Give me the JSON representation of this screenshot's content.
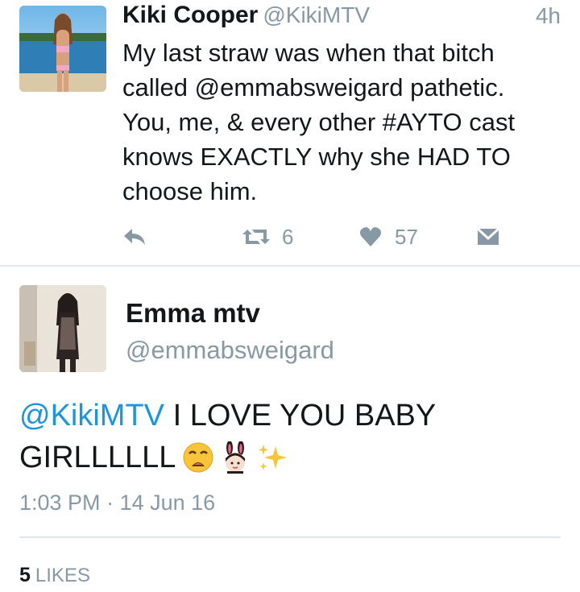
{
  "tweet1": {
    "name": "Kiki Cooper",
    "handle": "@KikiMTV",
    "time": "4h",
    "text": "My last straw was when that bitch called @emmabsweigard pathetic. You, me, & every other #AYTO cast knows EXACTLY why she HAD TO choose him.",
    "retweets": "6",
    "likes": "57",
    "icons": [
      "reply-icon",
      "retweet-icon",
      "heart-icon",
      "direct-message-icon"
    ]
  },
  "tweet2": {
    "name": "Emma mtv",
    "handle": "@emmabsweigard",
    "mention": "@KikiMTV",
    "text_line1": " I LOVE YOU BABY",
    "text_line2": "GIRLLLLLL",
    "emojis": [
      "weary-face-emoji",
      "bunny-girl-emoji",
      "sparkles-emoji"
    ],
    "time": "1:03 PM",
    "separator": "·",
    "date": "14 Jun 16",
    "likes_count": "5",
    "likes_label": "LIKES"
  },
  "colors": {
    "link": "#1b95e0",
    "muted": "#8899a6",
    "text": "#14171a",
    "divider": "#e1e8ed"
  }
}
